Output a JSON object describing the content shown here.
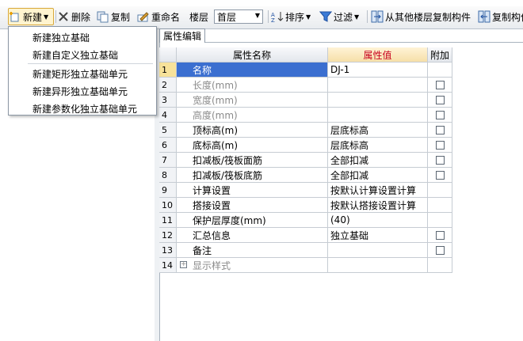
{
  "toolbar": {
    "new_label": "新建",
    "delete_label": "删除",
    "copy_label": "复制",
    "rename_label": "重命名",
    "floor_label": "楼层",
    "floor_value": "首层",
    "sort_label": "排序",
    "filter_label": "过滤",
    "copy_from_floor_label": "从其他楼层复制构件",
    "copy_to_label": "复制构件"
  },
  "menu": {
    "items": [
      "新建独立基础",
      "新建自定义独立基础",
      "新建矩形独立基础单元",
      "新建异形独立基础单元",
      "新建参数化独立基础单元"
    ]
  },
  "tab": {
    "label": "属性编辑"
  },
  "grid": {
    "headers": {
      "name": "属性名称",
      "value": "属性值",
      "add": "附加"
    },
    "rows": [
      {
        "num": "1",
        "name": "名称",
        "value": "DJ-1",
        "grey": false,
        "check": false,
        "selected": true
      },
      {
        "num": "2",
        "name": "长度(mm)",
        "value": "",
        "grey": true,
        "check": true
      },
      {
        "num": "3",
        "name": "宽度(mm)",
        "value": "",
        "grey": true,
        "check": true
      },
      {
        "num": "4",
        "name": "高度(mm)",
        "value": "",
        "grey": true,
        "check": true
      },
      {
        "num": "5",
        "name": "顶标高(m)",
        "value": "层底标高",
        "grey": false,
        "check": true
      },
      {
        "num": "6",
        "name": "底标高(m)",
        "value": "层底标高",
        "grey": false,
        "check": true
      },
      {
        "num": "7",
        "name": "扣减板/筏板面筋",
        "value": "全部扣减",
        "grey": false,
        "check": true
      },
      {
        "num": "8",
        "name": "扣减板/筏板底筋",
        "value": "全部扣减",
        "grey": false,
        "check": true
      },
      {
        "num": "9",
        "name": "计算设置",
        "value": "按默认计算设置计算",
        "grey": false,
        "check": false
      },
      {
        "num": "10",
        "name": "搭接设置",
        "value": "按默认搭接设置计算",
        "grey": false,
        "check": false
      },
      {
        "num": "11",
        "name": "保护层厚度(mm)",
        "value": "(40)",
        "grey": false,
        "check": false
      },
      {
        "num": "12",
        "name": "汇总信息",
        "value": "独立基础",
        "grey": false,
        "check": true
      },
      {
        "num": "13",
        "name": "备注",
        "value": "",
        "grey": false,
        "check": true
      },
      {
        "num": "14",
        "name": "显示样式",
        "value": "",
        "grey": true,
        "check": false,
        "expand": "+"
      }
    ]
  }
}
